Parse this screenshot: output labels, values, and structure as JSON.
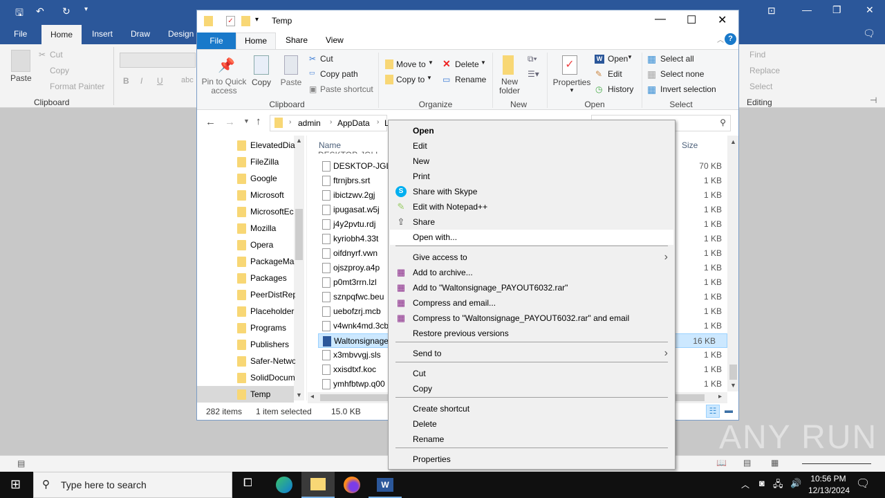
{
  "word": {
    "quick_access": [
      "save-icon",
      "undo-icon",
      "redo-icon",
      "customize-icon"
    ],
    "tabs": [
      "File",
      "Home",
      "Insert",
      "Draw",
      "Design"
    ],
    "clipboard": {
      "paste": "Paste",
      "cut": "Cut",
      "copy": "Copy",
      "format_painter": "Format Painter",
      "group": "Clipboard"
    },
    "font": {
      "bold": "B",
      "italic": "I",
      "underline": "U",
      "strike": "abc"
    },
    "editing": {
      "find": "Find",
      "replace": "Replace",
      "select": "Select",
      "group": "Editing"
    },
    "window_controls": {
      "restore": "⧉",
      "minimize": "—",
      "maximize": "❐",
      "close": "✕"
    }
  },
  "explorer": {
    "title": "Temp",
    "tabs": [
      "File",
      "Home",
      "Share",
      "View"
    ],
    "ribbon": {
      "clipboard": {
        "pin": "Pin to Quick access",
        "copy": "Copy",
        "paste": "Paste",
        "cut": "Cut",
        "copy_path": "Copy path",
        "paste_shortcut": "Paste shortcut",
        "group": "Clipboard"
      },
      "organize": {
        "move_to": "Move to",
        "copy_to": "Copy to",
        "delete": "Delete",
        "rename": "Rename",
        "group": "Organize"
      },
      "new": {
        "new_folder": "New folder",
        "group": "New"
      },
      "open": {
        "properties": "Properties",
        "open": "Open",
        "edit": "Edit",
        "history": "History",
        "group": "Open"
      },
      "select": {
        "select_all": "Select all",
        "select_none": "Select none",
        "invert": "Invert selection",
        "group": "Select"
      }
    },
    "address": {
      "crumbs": [
        "admin",
        "AppData",
        "L"
      ]
    },
    "nav_items": [
      "ElevatedDia",
      "FileZilla",
      "Google",
      "Microsoft",
      "MicrosoftEc",
      "Mozilla",
      "Opera",
      "PackageMa",
      "Packages",
      "PeerDistRep",
      "Placeholder",
      "Programs",
      "Publishers",
      "Safer-Netwo",
      "SolidDocum",
      "Temp"
    ],
    "columns": {
      "name": "Name",
      "size": "Size"
    },
    "files": [
      {
        "name": "DESKTOP-JGLL...",
        "size": "70 KB"
      },
      {
        "name": "ftrnjbrs.srt",
        "size": "1 KB"
      },
      {
        "name": "ibictzwv.2gj",
        "size": "1 KB"
      },
      {
        "name": "ipugasat.w5j",
        "size": "1 KB"
      },
      {
        "name": "j4y2pvtu.rdj",
        "size": "1 KB"
      },
      {
        "name": "kyriobh4.33t",
        "size": "1 KB"
      },
      {
        "name": "oifdnyrf.vwn",
        "size": "1 KB"
      },
      {
        "name": "ojszproy.a4p",
        "size": "1 KB"
      },
      {
        "name": "p0mt3rrn.lzl",
        "size": "1 KB"
      },
      {
        "name": "sznpqfwc.beu",
        "size": "1 KB"
      },
      {
        "name": "uebofzrj.mcb",
        "size": "1 KB"
      },
      {
        "name": "v4wnk4md.3cb",
        "size": "1 KB"
      },
      {
        "name": "Waltonsignage",
        "size": "16 KB",
        "selected": true
      },
      {
        "name": "x3mbvvgj.sls",
        "size": "1 KB"
      },
      {
        "name": "xxisdtxf.koc",
        "size": "1 KB"
      },
      {
        "name": "ymhfbtwp.q00",
        "size": "1 KB"
      }
    ],
    "status": {
      "items": "282 items",
      "selected": "1 item selected",
      "size": "15.0 KB"
    }
  },
  "context_menu": {
    "items": [
      {
        "label": "Open",
        "bold": true
      },
      {
        "label": "Edit"
      },
      {
        "label": "New"
      },
      {
        "label": "Print"
      },
      {
        "label": "Share with Skype",
        "icon": "skype-icon"
      },
      {
        "label": "Edit with Notepad++",
        "icon": "notepadpp-icon"
      },
      {
        "label": "Share",
        "icon": "share-icon"
      },
      {
        "label": "Open with...",
        "highlighted": true
      },
      {
        "label": "Give access to",
        "submenu": true
      },
      {
        "label": "Add to archive...",
        "icon": "winrar-icon"
      },
      {
        "label": "Add to \"Waltonsignage_PAYOUT6032.rar\"",
        "icon": "winrar-icon"
      },
      {
        "label": "Compress and email...",
        "icon": "winrar-icon"
      },
      {
        "label": "Compress to \"Waltonsignage_PAYOUT6032.rar\" and email",
        "icon": "winrar-icon"
      },
      {
        "label": "Restore previous versions"
      },
      {
        "label": "Send to",
        "submenu": true
      },
      {
        "label": "Cut"
      },
      {
        "label": "Copy"
      },
      {
        "label": "Create shortcut"
      },
      {
        "label": "Delete"
      },
      {
        "label": "Rename"
      },
      {
        "label": "Properties"
      }
    ]
  },
  "taskbar": {
    "search_placeholder": "Type here to search",
    "time": "10:56 PM",
    "date": "12/13/2024"
  },
  "watermark": "ANY RUN",
  "colors": {
    "word_blue": "#2b579a",
    "explorer_file_tab": "#1979ca",
    "selection": "#cce8ff",
    "taskbar": "#101010"
  }
}
